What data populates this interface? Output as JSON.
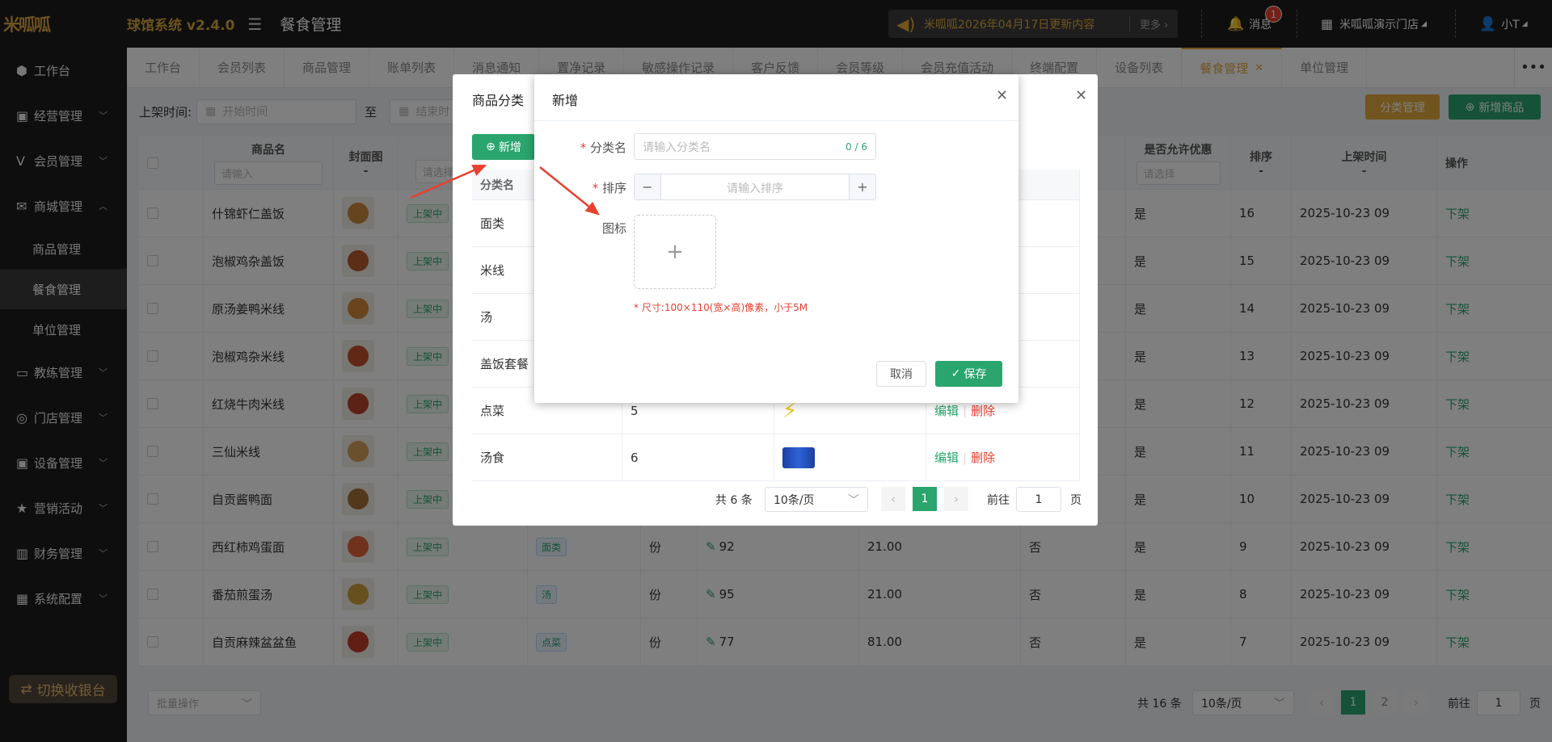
{
  "header": {
    "logo": "米呱呱",
    "app_name": "球馆系统 v2.4.0",
    "page_title": "餐食管理",
    "notice": "米呱呱2026年04月17日更新内容",
    "more": "更多",
    "messages": "消息",
    "msg_count": "1",
    "store": "米呱呱演示门店",
    "user": "小T"
  },
  "sidebar": {
    "items": [
      {
        "label": "工作台",
        "icon": "cube-icon"
      },
      {
        "label": "经营管理",
        "icon": "chart-icon"
      },
      {
        "label": "会员管理",
        "icon": "vip-icon"
      },
      {
        "label": "商城管理",
        "icon": "mail-icon"
      }
    ],
    "sub": [
      "商品管理",
      "餐食管理",
      "单位管理"
    ],
    "items2": [
      {
        "label": "教练管理"
      },
      {
        "label": "门店管理"
      },
      {
        "label": "设备管理"
      },
      {
        "label": "营销活动"
      },
      {
        "label": "财务管理"
      },
      {
        "label": "系统配置"
      }
    ],
    "cashier": "切换收银台"
  },
  "tabs": [
    "工作台",
    "会员列表",
    "商品管理",
    "账单列表",
    "消息通知",
    "置净记录",
    "敏感操作记录",
    "客户反馈",
    "会员等级",
    "会员充值活动",
    "终端配置",
    "设备列表",
    "餐食管理",
    "单位管理"
  ],
  "filter": {
    "label": "上架时间:",
    "start": "开始时间",
    "to": "至",
    "end": "结束时"
  },
  "buttons": {
    "cat": "分类管理",
    "new_goods": "新增商品"
  },
  "columns": {
    "name": "商品名",
    "cover": "封面图",
    "allow": "是否允许优惠",
    "sort": "排序",
    "time": "上架时间",
    "op": "操作",
    "input_ph": "请输入",
    "select_ph": "请选择",
    "dash": "-"
  },
  "rows": [
    {
      "name": "什锦虾仁盖饭",
      "status": "上架中",
      "allow": "是",
      "sort": "16",
      "time": "2025-10-23 09",
      "op": "下架"
    },
    {
      "name": "泡椒鸡杂盖饭",
      "status": "上架中",
      "allow": "是",
      "sort": "15",
      "time": "2025-10-23 09",
      "op": "下架"
    },
    {
      "name": "原汤姜鸭米线",
      "status": "上架中",
      "allow": "是",
      "sort": "14",
      "time": "2025-10-23 09",
      "op": "下架"
    },
    {
      "name": "泡椒鸡杂米线",
      "status": "上架中",
      "allow": "是",
      "sort": "13",
      "time": "2025-10-23 09",
      "op": "下架"
    },
    {
      "name": "红烧牛肉米线",
      "status": "上架中",
      "allow": "是",
      "sort": "12",
      "time": "2025-10-23 09",
      "op": "下架"
    },
    {
      "name": "三仙米线",
      "status": "上架中",
      "allow": "是",
      "sort": "11",
      "time": "2025-10-23 09",
      "op": "下架"
    },
    {
      "name": "自贡酱鸭面",
      "status": "上架中",
      "allow": "是",
      "sort": "10",
      "time": "2025-10-23 09",
      "op": "下架"
    },
    {
      "name": "西红柿鸡蛋面",
      "status": "上架中",
      "cat": "面类",
      "unit": "份",
      "stock": "92",
      "price": "21.00",
      "disc": "否",
      "allow": "是",
      "sort": "9",
      "time": "2025-10-23 09",
      "op": "下架"
    },
    {
      "name": "番茄煎蛋汤",
      "status": "上架中",
      "cat": "汤",
      "unit": "份",
      "stock": "95",
      "price": "21.00",
      "disc": "否",
      "allow": "是",
      "sort": "8",
      "time": "2025-10-23 09",
      "op": "下架"
    },
    {
      "name": "自贡麻辣盆盆鱼",
      "status": "上架中",
      "cat": "点菜",
      "unit": "份",
      "stock": "77",
      "price": "81.00",
      "disc": "否",
      "allow": "是",
      "sort": "7",
      "time": "2025-10-23 09",
      "op": "下架"
    }
  ],
  "pager": {
    "batch": "批量操作",
    "total": "共 16 条",
    "size": "10条/页",
    "p1": "1",
    "p2": "2",
    "goto": "前往",
    "goto_val": "1",
    "page": "页"
  },
  "cat_dialog": {
    "title": "商品分类",
    "new": "新增",
    "col_name": "分类名",
    "rows": [
      {
        "name": "面类"
      },
      {
        "name": "米线"
      },
      {
        "name": "汤"
      },
      {
        "name": "盖饭套餐"
      },
      {
        "name": "点菜",
        "sort": "5",
        "edit": "编辑",
        "del": "删除"
      },
      {
        "name": "汤食",
        "sort": "6",
        "edit": "编辑",
        "del": "删除"
      }
    ],
    "total": "共 6 条",
    "size": "10条/页",
    "page": "1",
    "goto": "前往",
    "goto_val": "1",
    "page_unit": "页"
  },
  "add_dialog": {
    "title": "新增",
    "name_label": "分类名",
    "name_ph": "请输入分类名",
    "counter": "0 / 6",
    "sort_label": "排序",
    "sort_ph": "请输入排序",
    "icon_label": "图标",
    "hint": "* 尺寸:100×110(宽×高)像素，小于5M",
    "cancel": "取消",
    "save": "保存"
  }
}
